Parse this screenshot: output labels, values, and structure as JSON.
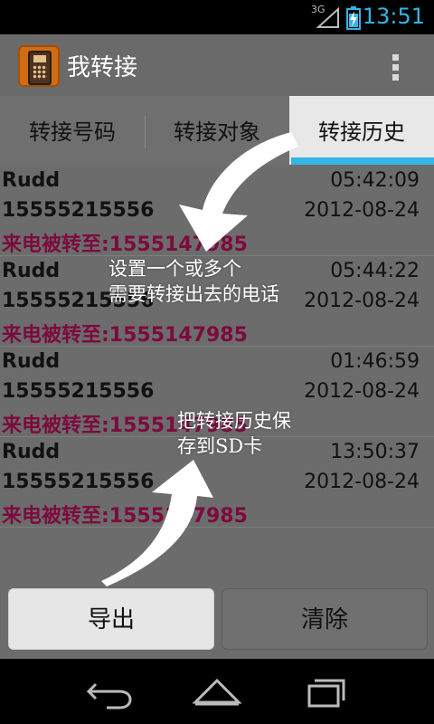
{
  "status_bar": {
    "network": "3G",
    "time": "13:51"
  },
  "action_bar": {
    "title": "我转接",
    "icon": "app-phone-icon",
    "menu_icon": "overflow-menu-icon"
  },
  "tabs": [
    {
      "label": "转接号码",
      "selected": false
    },
    {
      "label": "转接对象",
      "selected": false
    },
    {
      "label": "转接历史",
      "selected": true
    }
  ],
  "records": [
    {
      "name": "Rudd",
      "time": "05:42:09",
      "number": "15555215556",
      "date": "2012-08-24",
      "forwarded": "来电被转至:1555147985"
    },
    {
      "name": "Rudd",
      "time": "05:44:22",
      "number": "15555215556",
      "date": "2012-08-24",
      "forwarded": "来电被转至:1555147985"
    },
    {
      "name": "Rudd",
      "time": "01:46:59",
      "number": "15555215556",
      "date": "2012-08-24",
      "forwarded": "来电被转至:1555147985"
    },
    {
      "name": "Rudd",
      "time": "13:50:37",
      "number": "15555215556",
      "date": "2012-08-24",
      "forwarded": "来电被转至:1555147985"
    }
  ],
  "hints": {
    "hint1_line1": "设置一个或多个",
    "hint1_line2": "需要转接出去的电话",
    "hint2_line1": "把转接历史保",
    "hint2_line2": "存到SD卡"
  },
  "buttons": {
    "export": "导出",
    "clear": "清除"
  },
  "colors": {
    "accent": "#33b5e5",
    "forward_text": "#7d0a3e"
  },
  "nav": {
    "back_icon": "back-icon",
    "home_icon": "home-icon",
    "recents_icon": "recents-icon"
  }
}
